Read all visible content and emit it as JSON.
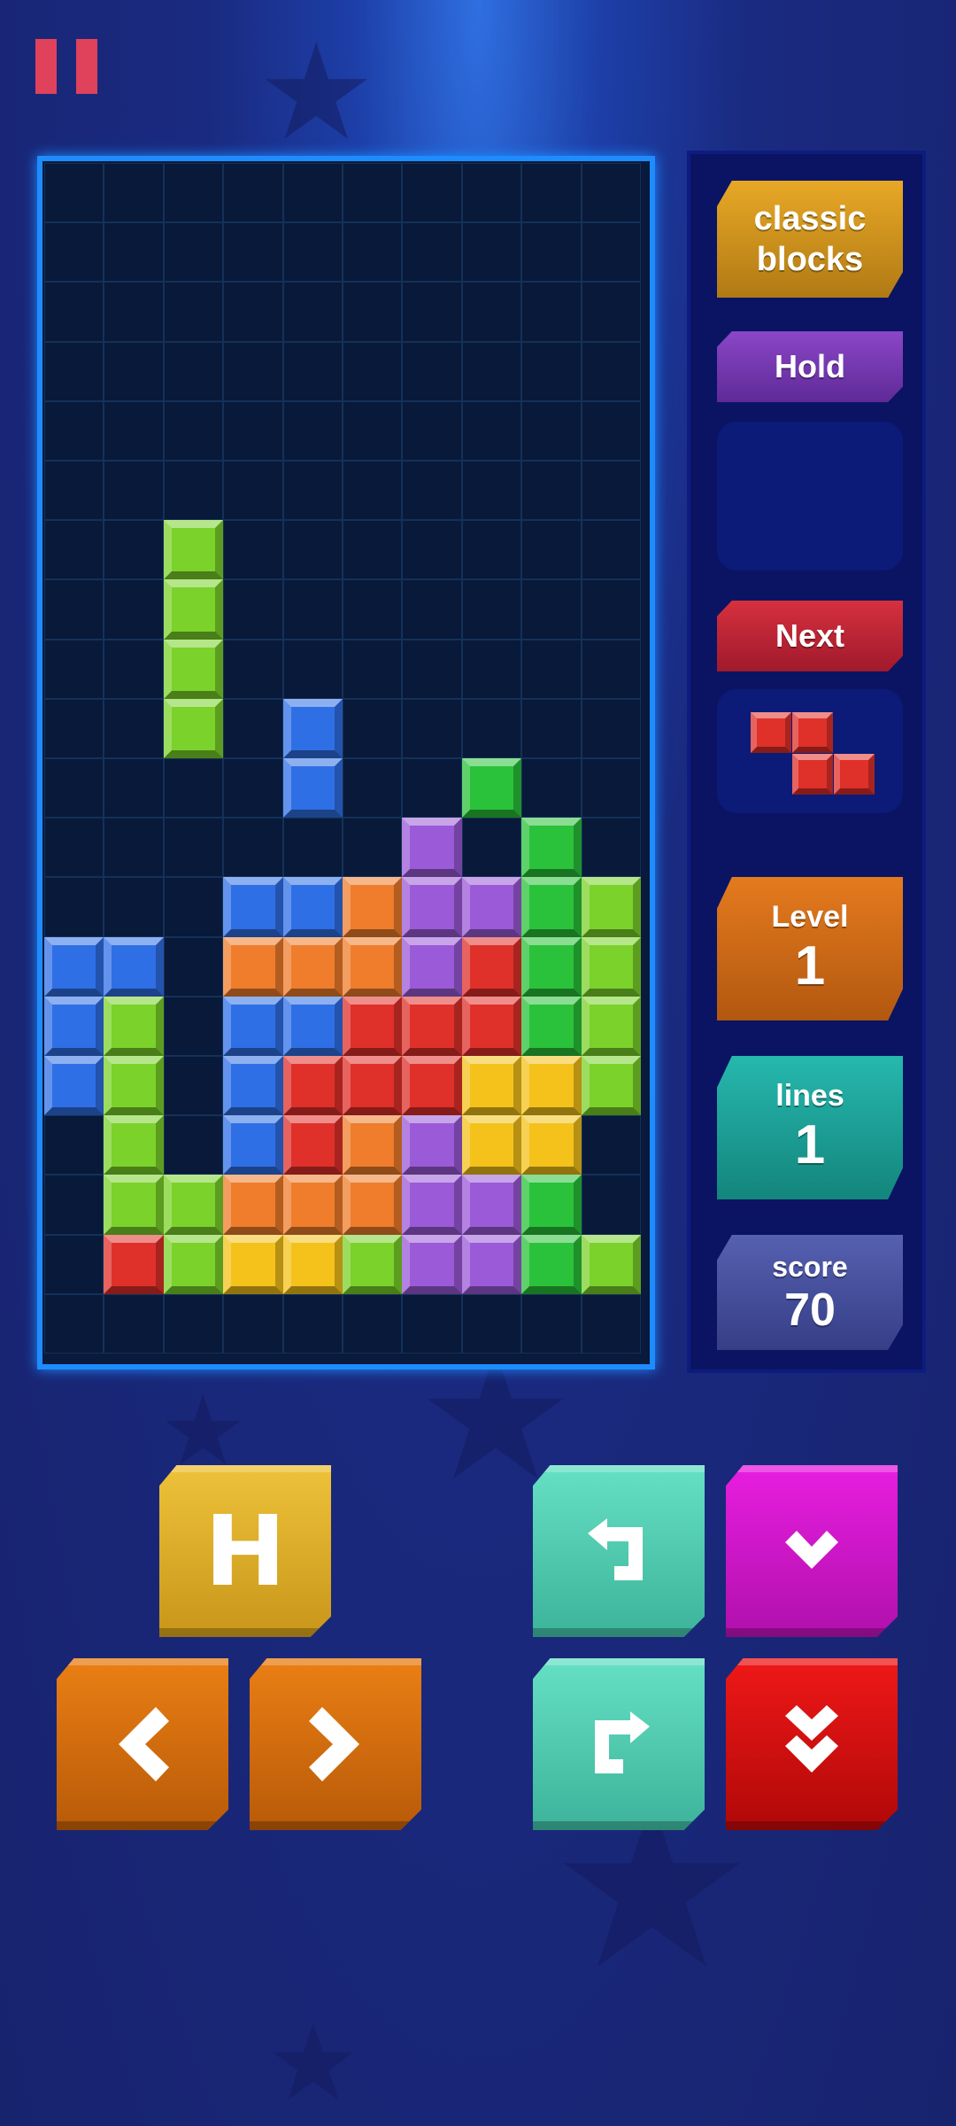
{
  "colors": {
    "green": "#7bd22b",
    "green_dark": "#2ac23a",
    "blue": "#2f6fe6",
    "purple": "#9b5ad8",
    "orange": "#ef7d2c",
    "red": "#e0302a",
    "yellow": "#f4c21a",
    "gold_label": "#d89a1c",
    "hold_label": "#7c3cb4",
    "next_label": "#c8263a",
    "level_label": "#d06a14",
    "lines_label": "#1aa49c",
    "score_label": "#464f9e"
  },
  "board": {
    "cols": 10,
    "rows": 21,
    "falling_piece": {
      "color": "green",
      "cells": [
        [
          2,
          6
        ],
        [
          2,
          7
        ],
        [
          2,
          8
        ],
        [
          2,
          9
        ]
      ]
    },
    "stack_rows": [
      "....B.....",
      "....B..G..",
      "......P.G.",
      "...BBOPPGL",
      "BB.OOOPRGL",
      "BL.BBRRRGL",
      "BL.BRRRYYL",
      ".L.BROPYY.",
      ".LLOOOPPG.",
      ".RLYYLPPGL"
    ],
    "stack_top_row": 11
  },
  "side": {
    "mode_label": "classic blocks",
    "hold_label": "Hold",
    "next_label": "Next",
    "next_piece": {
      "color": "red",
      "cells": [
        [
          0,
          0
        ],
        [
          1,
          0
        ],
        [
          1,
          1
        ],
        [
          2,
          1
        ]
      ]
    },
    "level": {
      "title": "Level",
      "value": "1"
    },
    "lines": {
      "title": "lines",
      "value": "1"
    },
    "score": {
      "title": "score",
      "value": "70"
    }
  },
  "controls": {
    "hold_button": "H",
    "buttons": [
      "hold",
      "rotate-left",
      "soft-drop",
      "move-left",
      "move-right",
      "rotate-right",
      "hard-drop"
    ],
    "icons": {
      "pause": "pause-icon",
      "rotate_left": "rotate-left-icon",
      "rotate_right": "rotate-right-icon",
      "soft_drop": "chevron-down-icon",
      "hard_drop": "double-chevron-down-icon",
      "left": "chevron-left-icon",
      "right": "chevron-right-icon"
    }
  }
}
